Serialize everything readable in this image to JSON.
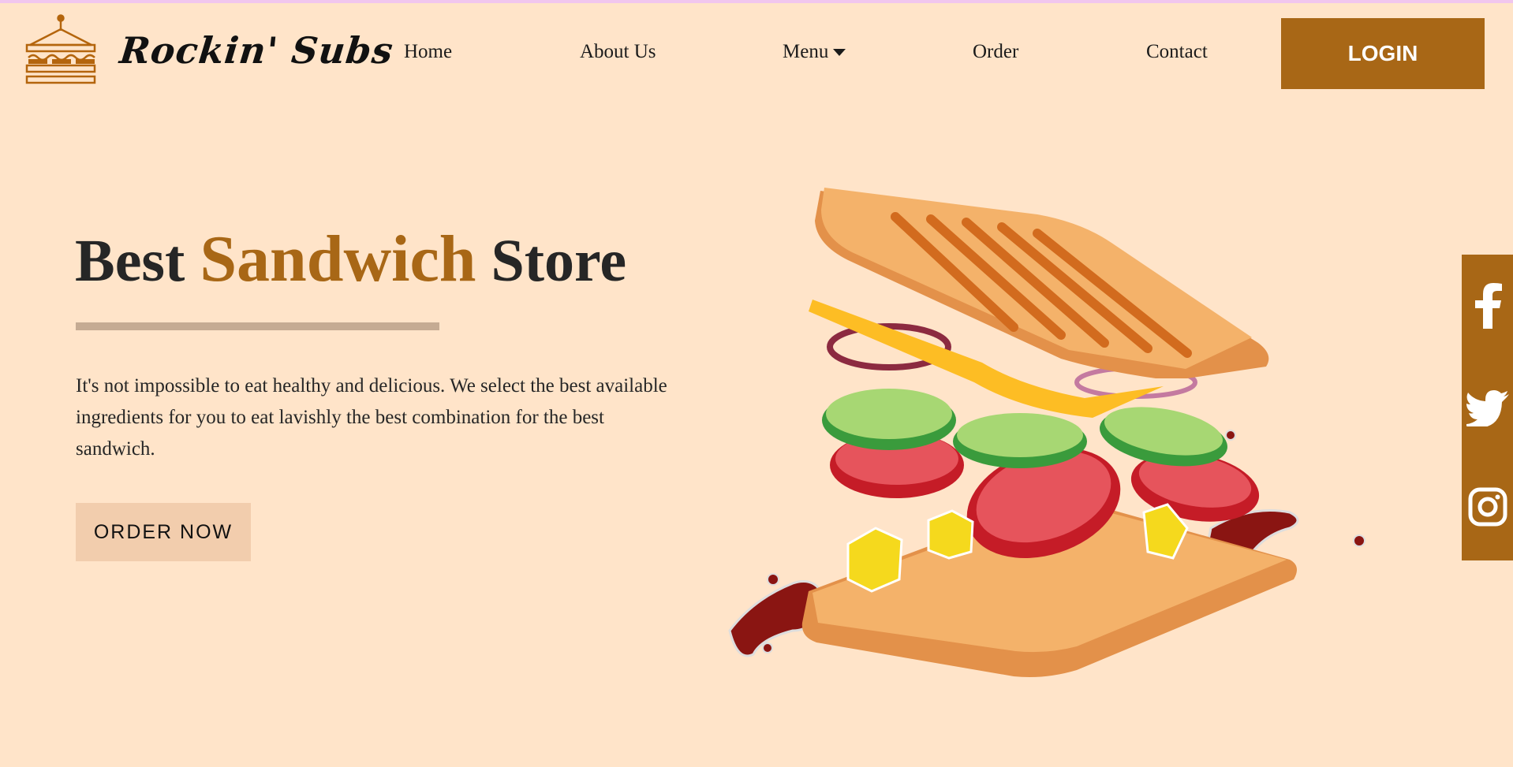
{
  "header": {
    "brand": "Rockin' Subs",
    "nav": [
      {
        "label": "Home"
      },
      {
        "label": "About Us"
      },
      {
        "label": "Menu"
      },
      {
        "label": "Order"
      },
      {
        "label": "Contact"
      }
    ],
    "login_label": "LOGIN"
  },
  "hero": {
    "title_start": "Best ",
    "title_accent": "Sandwich",
    "title_end": " Store",
    "description": "It's not impossible to eat healthy and delicious. We select the best available ingredients for you to eat lavishly the best combination for the best sandwich.",
    "cta_label": "ORDER NOW"
  },
  "social": [
    {
      "icon": "facebook-icon"
    },
    {
      "icon": "twitter-icon"
    },
    {
      "icon": "instagram-icon"
    }
  ],
  "colors": {
    "background": "#ffe4c9",
    "accent": "#a86716",
    "cta_background": "#f2cdad"
  }
}
